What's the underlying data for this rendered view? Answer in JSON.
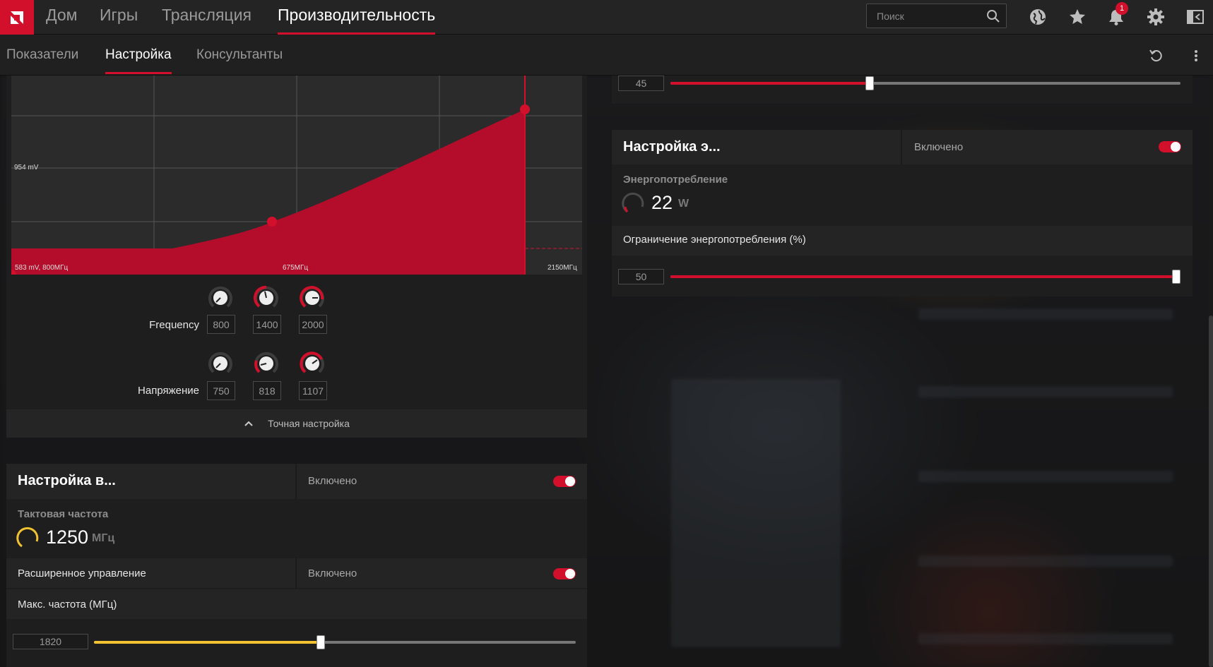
{
  "colors": {
    "accent": "#d2102c",
    "clock_gauge": "#f2c230",
    "slider_fill_clock": "#f2c230"
  },
  "top_nav": {
    "tabs": [
      "Дом",
      "Игры",
      "Трансляция",
      "Производительность"
    ],
    "active_tab": "Производительность",
    "search_placeholder": "Поиск",
    "notifications_count": "1",
    "icons": [
      "amd-logo-icon",
      "search-icon",
      "globe-icon",
      "star-icon",
      "bell-icon",
      "gear-icon",
      "sidebar-toggle-icon"
    ]
  },
  "sub_nav": {
    "tabs": [
      "Показатели",
      "Настройка",
      "Консультанты"
    ],
    "active_tab": "Настройка",
    "icons": [
      "reset-icon",
      "more-vertical-icon"
    ]
  },
  "curve_panel": {
    "chart_data": {
      "type": "area",
      "y_label_mid": "954 mV",
      "x_labels": [
        "583 mV, 800МГц",
        "675МГц",
        "2150МГц"
      ],
      "points": [
        {
          "freq": 800,
          "mv": 750
        },
        {
          "freq": 1400,
          "mv": 818
        },
        {
          "freq": 2000,
          "mv": 1107
        }
      ]
    },
    "frequency": {
      "label": "Frequency",
      "values": [
        "800",
        "1400",
        "2000"
      ]
    },
    "voltage": {
      "label": "Напряжение",
      "values": [
        "750",
        "818",
        "1107"
      ]
    },
    "fine_tune_label": "Точная настройка"
  },
  "vram_panel": {
    "title": "Настройка в...",
    "state": "Включено",
    "clock_label": "Тактовая частота",
    "clock_value": "1250",
    "clock_unit": "МГц",
    "advanced_label": "Расширенное управление",
    "advanced_state": "Включено",
    "max_freq_label": "Макс. частота (МГц)",
    "max_freq_value": "1820",
    "max_freq_fraction": 0.47
  },
  "right_top_slider": {
    "value": "45",
    "fraction": 0.39
  },
  "power_panel": {
    "title": "Настройка э...",
    "state": "Включено",
    "consumption_label": "Энергопотребление",
    "consumption_value": "22",
    "consumption_unit": "W",
    "limit_label": "Ограничение энергопотребления (%)",
    "limit_value": "50",
    "limit_fraction": 1.0
  }
}
